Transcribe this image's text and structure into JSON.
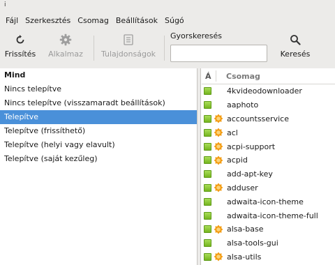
{
  "window": {
    "icon": "app-window-icon"
  },
  "menu": [
    "Fájl",
    "Szerkesztés",
    "Csomag",
    "Beállítások",
    "Súgó"
  ],
  "toolbar": {
    "refresh_label": "Frissítés",
    "apply_label": "Alkalmaz",
    "properties_label": "Tulajdonságok",
    "quick_search_label": "Gyorskeresés",
    "quick_search_value": "",
    "search_label": "Keresés"
  },
  "filters": {
    "header": "Mind",
    "items": [
      "Nincs telepítve",
      "Nincs telepítve (visszamaradt beállítások)",
      "Telepítve",
      "Telepítve (frissíthető)",
      "Telepítve (helyi vagy elavult)",
      "Telepítve (saját kezűleg)"
    ],
    "selected_index": 2
  },
  "packages": {
    "status_header": "Á",
    "name_header": "Csomag",
    "installed_color": "#8cc63f",
    "support_badge_color": "#f39c12",
    "rows": [
      {
        "name": "4kvideodownloader",
        "badge": false
      },
      {
        "name": "aaphoto",
        "badge": false
      },
      {
        "name": "accountsservice",
        "badge": true
      },
      {
        "name": "acl",
        "badge": true
      },
      {
        "name": "acpi-support",
        "badge": true
      },
      {
        "name": "acpid",
        "badge": true
      },
      {
        "name": "add-apt-key",
        "badge": false
      },
      {
        "name": "adduser",
        "badge": true
      },
      {
        "name": "adwaita-icon-theme",
        "badge": false
      },
      {
        "name": "adwaita-icon-theme-full",
        "badge": false
      },
      {
        "name": "alsa-base",
        "badge": true
      },
      {
        "name": "alsa-tools-gui",
        "badge": false
      },
      {
        "name": "alsa-utils",
        "badge": true
      }
    ]
  }
}
